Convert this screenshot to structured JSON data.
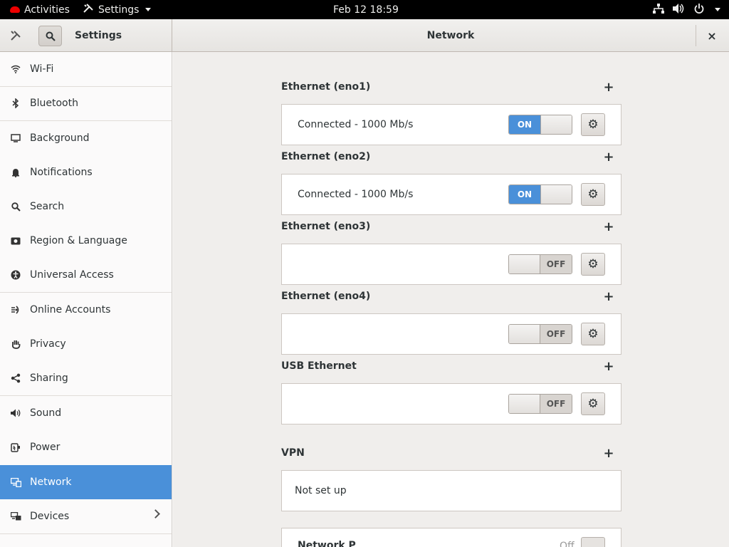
{
  "topbar": {
    "activities": "Activities",
    "app_menu": "Settings",
    "clock": "Feb 12  18:59",
    "tray_icons": [
      "network-icon",
      "volume-icon",
      "power-icon",
      "system-menu-caret"
    ]
  },
  "headerbar": {
    "sidebar_title": "Settings",
    "main_title": "Network",
    "close": "×"
  },
  "sidebar": {
    "items": [
      {
        "label": "Wi-Fi",
        "icon": "wifi-icon"
      },
      {
        "label": "Bluetooth",
        "icon": "bluetooth-icon"
      },
      {
        "label": "Background",
        "icon": "background-icon"
      },
      {
        "label": "Notifications",
        "icon": "bell-icon"
      },
      {
        "label": "Search",
        "icon": "search-icon"
      },
      {
        "label": "Region & Language",
        "icon": "region-icon"
      },
      {
        "label": "Universal Access",
        "icon": "accessibility-icon"
      },
      {
        "label": "Online Accounts",
        "icon": "online-accounts-icon"
      },
      {
        "label": "Privacy",
        "icon": "privacy-hand-icon"
      },
      {
        "label": "Sharing",
        "icon": "share-icon"
      },
      {
        "label": "Sound",
        "icon": "speaker-icon"
      },
      {
        "label": "Power",
        "icon": "power-plug-icon"
      },
      {
        "label": "Network",
        "icon": "network-icon",
        "selected": true
      },
      {
        "label": "Devices",
        "icon": "devices-icon",
        "has_submenu": true
      }
    ]
  },
  "network": {
    "sections": [
      {
        "title": "Ethernet (eno1)",
        "status": "Connected - 1000 Mb/s",
        "switch": "ON"
      },
      {
        "title": "Ethernet (eno2)",
        "status": "Connected - 1000 Mb/s",
        "switch": "ON"
      },
      {
        "title": "Ethernet (eno3)",
        "status": "",
        "switch": "OFF"
      },
      {
        "title": "Ethernet (eno4)",
        "status": "",
        "switch": "OFF"
      },
      {
        "title": "USB Ethernet",
        "status": "",
        "switch": "OFF"
      }
    ],
    "vpn": {
      "title": "VPN",
      "status": "Not set up"
    },
    "proxy_partial": {
      "label": "Network P",
      "value": "Off"
    },
    "add_label": "+",
    "gear_label": "⚙"
  },
  "colors": {
    "accent": "#4a90d9",
    "topbar": "#000000",
    "sidebar_bg": "#fbfafa",
    "content_bg": "#f0eeec"
  }
}
